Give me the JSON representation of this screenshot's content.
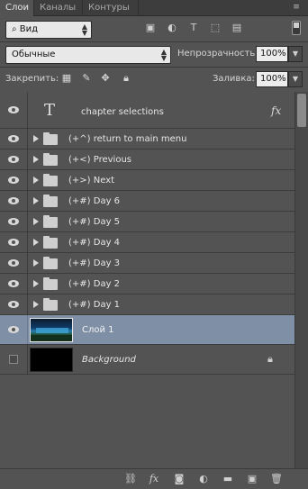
{
  "tabs": [
    {
      "label": "Слои"
    },
    {
      "label": "Каналы"
    },
    {
      "label": "Контуры"
    }
  ],
  "filter": {
    "kind_label": "Вид"
  },
  "blend": {
    "mode": "Обычные",
    "opacity_label": "Непрозрачность:",
    "opacity_value": "100%"
  },
  "lock": {
    "label": "Закрепить:",
    "fill_label": "Заливка:",
    "fill_value": "100%"
  },
  "layers": [
    {
      "name": "chapter selections",
      "type": "text",
      "visible": true,
      "fx": "fx"
    },
    {
      "name": "(+^) return to main menu",
      "type": "group",
      "visible": true
    },
    {
      "name": "(+<) Previous",
      "type": "group",
      "visible": true
    },
    {
      "name": "(+>) Next",
      "type": "group",
      "visible": true
    },
    {
      "name": "(+#) Day 6",
      "type": "group",
      "visible": true
    },
    {
      "name": "(+#) Day 5",
      "type": "group",
      "visible": true
    },
    {
      "name": "(+#) Day 4",
      "type": "group",
      "visible": true
    },
    {
      "name": "(+#) Day 3",
      "type": "group",
      "visible": true
    },
    {
      "name": "(+#) Day 2",
      "type": "group",
      "visible": true
    },
    {
      "name": "(+#) Day 1",
      "type": "group",
      "visible": true
    },
    {
      "name": "Слой 1",
      "type": "pixel",
      "visible": true,
      "selected": true
    },
    {
      "name": "Background",
      "type": "background",
      "visible": false,
      "locked": true
    }
  ],
  "text_glyph": "T",
  "footer_fx": "fx",
  "colors": {
    "panel": "#535353",
    "selected_row": "#7e8fa6",
    "tab_bar": "#3d3d3d"
  }
}
